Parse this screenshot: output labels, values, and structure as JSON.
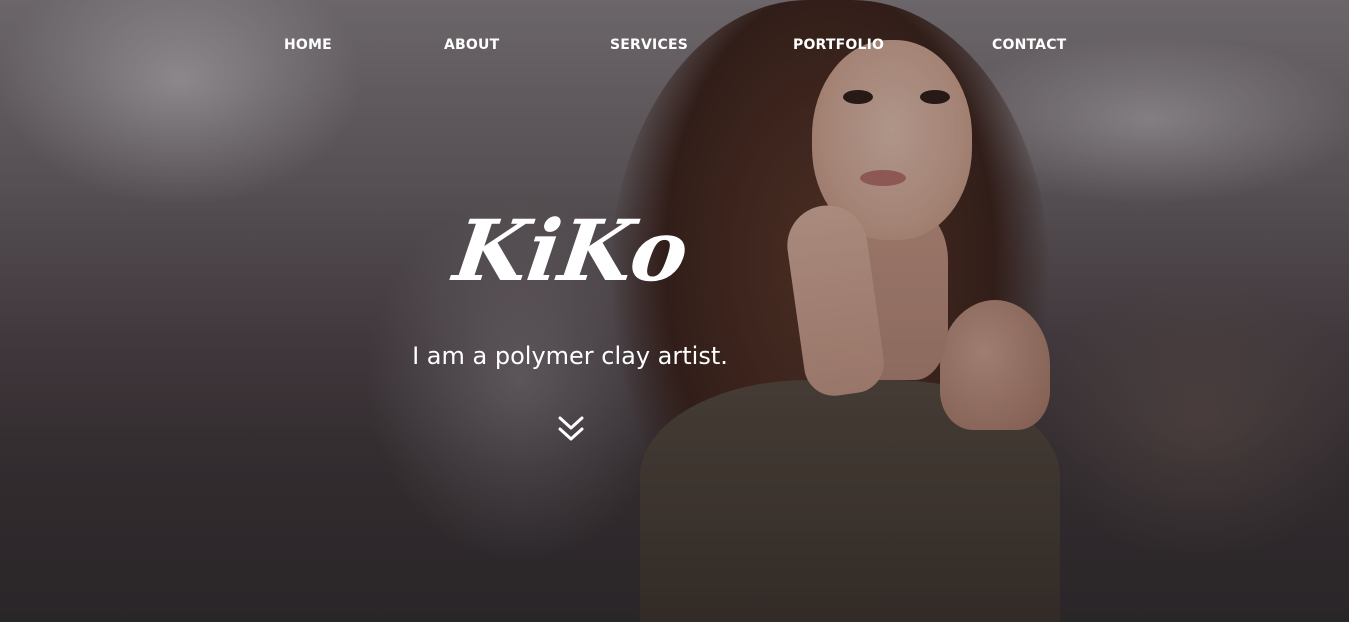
{
  "nav": {
    "items": [
      {
        "label": "HOME"
      },
      {
        "label": "ABOUT"
      },
      {
        "label": "SERVICES"
      },
      {
        "label": "PORTFOLIO"
      },
      {
        "label": "CONTACT"
      }
    ]
  },
  "hero": {
    "logo_text": "KiKo",
    "tagline": "I am a polymer clay artist.",
    "scroll_icon": "double-chevron-down-icon"
  },
  "colors": {
    "text": "#ffffff",
    "overlay": "#1e1a1c"
  }
}
